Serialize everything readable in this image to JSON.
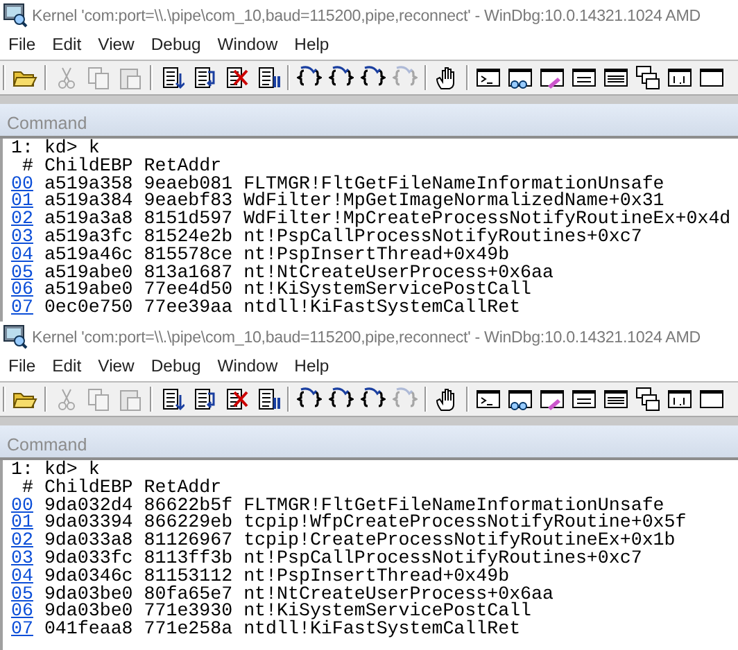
{
  "windows": [
    {
      "title": "Kernel 'com:port=\\\\.\\pipe\\com_10,baud=115200,pipe,reconnect' - WinDbg:10.0.14321.1024 AMD",
      "menu": [
        "File",
        "Edit",
        "View",
        "Debug",
        "Window",
        "Help"
      ],
      "toolbar": [
        {
          "kind": "separator"
        },
        {
          "kind": "open",
          "disabled": false
        },
        {
          "kind": "separator"
        },
        {
          "kind": "cut",
          "disabled": true
        },
        {
          "kind": "copy",
          "disabled": true
        },
        {
          "kind": "paste",
          "disabled": true
        },
        {
          "kind": "separator"
        },
        {
          "kind": "doc-down",
          "disabled": false
        },
        {
          "kind": "doc-loop",
          "disabled": false
        },
        {
          "kind": "doc-cross",
          "disabled": false
        },
        {
          "kind": "doc-pause",
          "disabled": false
        },
        {
          "kind": "separator"
        },
        {
          "kind": "brace-in",
          "disabled": false
        },
        {
          "kind": "brace-over",
          "disabled": false
        },
        {
          "kind": "brace-out",
          "disabled": false
        },
        {
          "kind": "brace-cursor",
          "disabled": true
        },
        {
          "kind": "separator"
        },
        {
          "kind": "hand",
          "disabled": false
        },
        {
          "kind": "separator"
        },
        {
          "kind": "console",
          "disabled": false
        },
        {
          "kind": "watch",
          "disabled": false
        },
        {
          "kind": "locals",
          "disabled": false
        },
        {
          "kind": "registers",
          "disabled": false
        },
        {
          "kind": "memory",
          "disabled": false
        },
        {
          "kind": "stack",
          "disabled": false
        },
        {
          "kind": "disasm",
          "disabled": false
        },
        {
          "kind": "blank",
          "disabled": false
        }
      ],
      "pane_title": "Command",
      "prompt": "1: kd> k",
      "header": [
        "#",
        "ChildEBP",
        "RetAddr"
      ],
      "frames": [
        {
          "index": "00",
          "child_ebp": "a519a358",
          "ret_addr": "9eaeb081",
          "call_site": "FLTMGR!FltGetFileNameInformationUnsafe"
        },
        {
          "index": "01",
          "child_ebp": "a519a384",
          "ret_addr": "9eaebf83",
          "call_site": "WdFilter!MpGetImageNormalizedName+0x31"
        },
        {
          "index": "02",
          "child_ebp": "a519a3a8",
          "ret_addr": "8151d597",
          "call_site": "WdFilter!MpCreateProcessNotifyRoutineEx+0x4d"
        },
        {
          "index": "03",
          "child_ebp": "a519a3fc",
          "ret_addr": "81524e2b",
          "call_site": "nt!PspCallProcessNotifyRoutines+0xc7"
        },
        {
          "index": "04",
          "child_ebp": "a519a46c",
          "ret_addr": "815578ce",
          "call_site": "nt!PspInsertThread+0x49b"
        },
        {
          "index": "05",
          "child_ebp": "a519abe0",
          "ret_addr": "813a1687",
          "call_site": "nt!NtCreateUserProcess+0x6aa"
        },
        {
          "index": "06",
          "child_ebp": "a519abe0",
          "ret_addr": "77ee4d50",
          "call_site": "nt!KiSystemServicePostCall"
        },
        {
          "index": "07",
          "child_ebp": "0ec0e750",
          "ret_addr": "77ee39aa",
          "call_site": "ntdll!KiFastSystemCallRet"
        }
      ]
    },
    {
      "title": "Kernel 'com:port=\\\\.\\pipe\\com_10,baud=115200,pipe,reconnect' - WinDbg:10.0.14321.1024 AMD",
      "menu": [
        "File",
        "Edit",
        "View",
        "Debug",
        "Window",
        "Help"
      ],
      "toolbar": [
        {
          "kind": "separator"
        },
        {
          "kind": "open",
          "disabled": false
        },
        {
          "kind": "separator"
        },
        {
          "kind": "cut",
          "disabled": true
        },
        {
          "kind": "copy",
          "disabled": true
        },
        {
          "kind": "paste",
          "disabled": true
        },
        {
          "kind": "separator"
        },
        {
          "kind": "doc-down",
          "disabled": false
        },
        {
          "kind": "doc-loop",
          "disabled": false
        },
        {
          "kind": "doc-cross",
          "disabled": false
        },
        {
          "kind": "doc-pause",
          "disabled": false
        },
        {
          "kind": "separator"
        },
        {
          "kind": "brace-in",
          "disabled": false
        },
        {
          "kind": "brace-over",
          "disabled": false
        },
        {
          "kind": "brace-out",
          "disabled": false
        },
        {
          "kind": "brace-cursor",
          "disabled": true
        },
        {
          "kind": "separator"
        },
        {
          "kind": "hand",
          "disabled": false
        },
        {
          "kind": "separator"
        },
        {
          "kind": "console",
          "disabled": false
        },
        {
          "kind": "watch",
          "disabled": false
        },
        {
          "kind": "locals",
          "disabled": false
        },
        {
          "kind": "registers",
          "disabled": false
        },
        {
          "kind": "memory",
          "disabled": false
        },
        {
          "kind": "stack",
          "disabled": false
        },
        {
          "kind": "disasm",
          "disabled": false
        },
        {
          "kind": "blank",
          "disabled": false
        }
      ],
      "pane_title": "Command",
      "prompt": "1: kd> k",
      "header": [
        "#",
        "ChildEBP",
        "RetAddr"
      ],
      "frames": [
        {
          "index": "00",
          "child_ebp": "9da032d4",
          "ret_addr": "86622b5f",
          "call_site": "FLTMGR!FltGetFileNameInformationUnsafe"
        },
        {
          "index": "01",
          "child_ebp": "9da03394",
          "ret_addr": "866229eb",
          "call_site": "tcpip!WfpCreateProcessNotifyRoutine+0x5f"
        },
        {
          "index": "02",
          "child_ebp": "9da033a8",
          "ret_addr": "81126967",
          "call_site": "tcpip!CreateProcessNotifyRoutineEx+0x1b"
        },
        {
          "index": "03",
          "child_ebp": "9da033fc",
          "ret_addr": "8113ff3b",
          "call_site": "nt!PspCallProcessNotifyRoutines+0xc7"
        },
        {
          "index": "04",
          "child_ebp": "9da0346c",
          "ret_addr": "81153112",
          "call_site": "nt!PspInsertThread+0x49b"
        },
        {
          "index": "05",
          "child_ebp": "9da03be0",
          "ret_addr": "80fa65e7",
          "call_site": "nt!NtCreateUserProcess+0x6aa"
        },
        {
          "index": "06",
          "child_ebp": "9da03be0",
          "ret_addr": "771e3930",
          "call_site": "nt!KiSystemServicePostCall"
        },
        {
          "index": "07",
          "child_ebp": "041feaa8",
          "ret_addr": "771e258a",
          "call_site": "ntdll!KiFastSystemCallRet"
        }
      ]
    }
  ]
}
